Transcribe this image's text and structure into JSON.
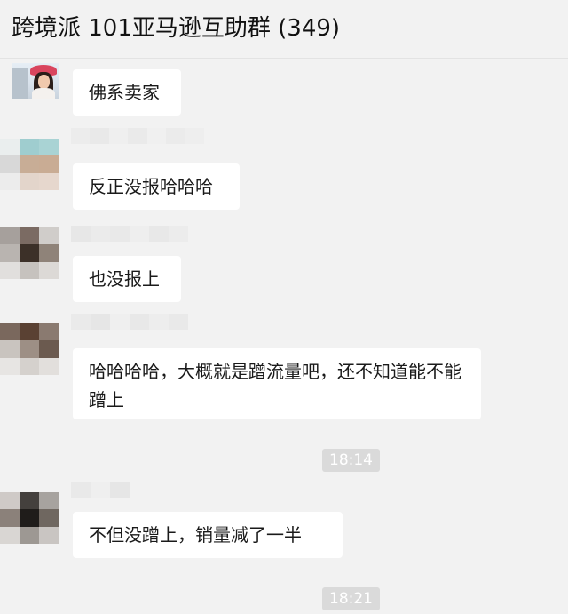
{
  "header": {
    "title": "跨境派 101亚马逊互助群 (349)"
  },
  "messages": [
    {
      "text": "佛系卖家"
    },
    {
      "text": "反正没报哈哈哈"
    },
    {
      "text": "也没报上"
    },
    {
      "text": "哈哈哈哈，大概就是蹭流量吧，还不知道能不能蹭上"
    },
    {
      "text": "不但没蹭上，销量减了一半"
    }
  ],
  "timestamps": [
    "18:14",
    "18:21"
  ],
  "avatars": [
    {
      "icon": "user-photo-avatar"
    },
    {
      "icon": "blurred-avatar",
      "colors": [
        "#eaeeee",
        "#9fcdcf",
        "#a9d3d4",
        "#d8d8d8",
        "#c8ad96",
        "#c9ac94",
        "#ececec",
        "#e3d5cb",
        "#e6d7cd"
      ]
    },
    {
      "icon": "blurred-avatar",
      "colors": [
        "#a6a09c",
        "#7b6b63",
        "#d0cdca",
        "#b9b4b0",
        "#3c3028",
        "#8f8379",
        "#e1dfdd",
        "#c6c2be",
        "#dcd9d6"
      ]
    },
    {
      "icon": "blurred-avatar",
      "colors": [
        "#7a685d",
        "#5a4133",
        "#8a7a70",
        "#c9c4bf",
        "#9d8f85",
        "#6b5a4f",
        "#e7e5e3",
        "#d5d1cd",
        "#e2dfdc"
      ]
    },
    {
      "icon": "blurred-avatar",
      "colors": [
        "#cfcac7",
        "#44403d",
        "#a7a39f",
        "#8b817a",
        "#1f1c1a",
        "#6f6760",
        "#d9d6d3",
        "#9d9893",
        "#c9c5c2"
      ]
    }
  ],
  "names": [
    {
      "colors": [
        "#ececec",
        "#e9e9e9",
        "#efefef",
        "#eaeaea",
        "#f0f0f0",
        "#ebebeb",
        "#eeeeee"
      ]
    },
    {
      "colors": [
        "#e7e7e7",
        "#ebebeb",
        "#e9e9e9",
        "#eeeeee",
        "#e8e8e8",
        "#ececec"
      ]
    },
    {
      "colors": [
        "#eaeaea",
        "#e6e6e6",
        "#efefef",
        "#e8e8e8",
        "#ededed",
        "#e9e9e9"
      ]
    },
    {
      "colors": [
        "#e9e9e9",
        "#efefef",
        "#e6e6e6"
      ]
    }
  ]
}
